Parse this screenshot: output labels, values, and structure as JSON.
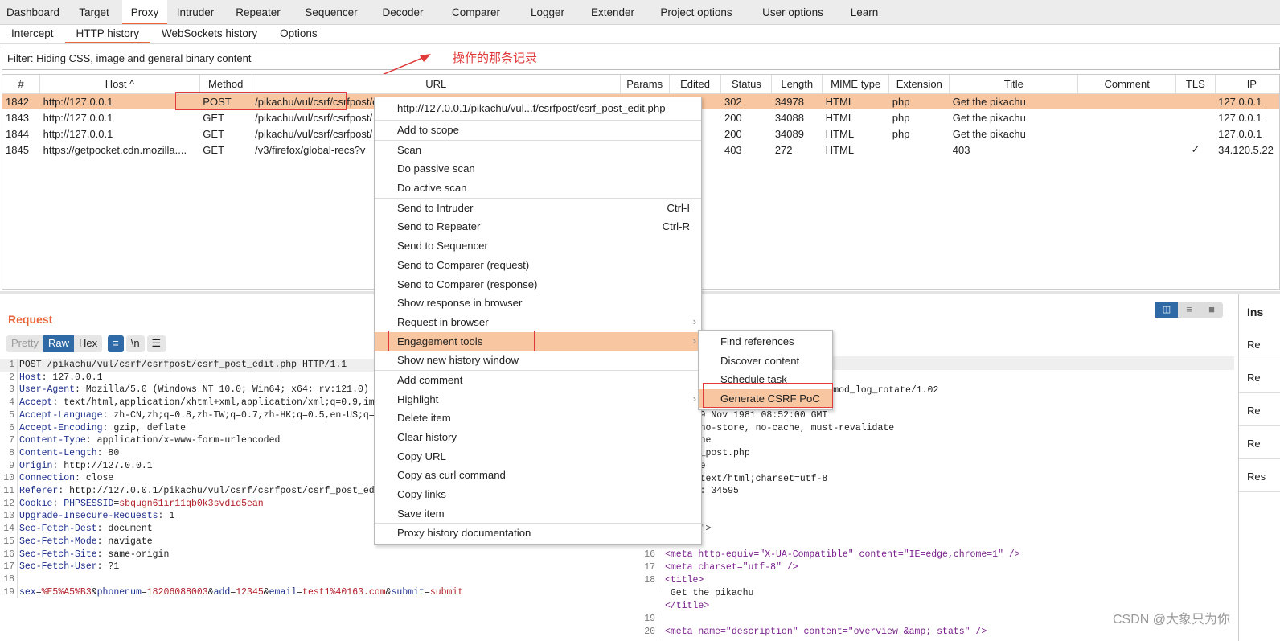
{
  "main_tabs": [
    "Dashboard",
    "Target",
    "Proxy",
    "Intruder",
    "Repeater",
    "Sequencer",
    "Decoder",
    "Comparer",
    "Logger",
    "Extender",
    "Project options",
    "User options",
    "Learn"
  ],
  "active_main_tab": "Proxy",
  "sub_tabs": [
    "Intercept",
    "HTTP history",
    "WebSockets history",
    "Options"
  ],
  "active_sub_tab": "HTTP history",
  "filter": "Filter: Hiding CSS, image and general binary content",
  "annotation": "操作的那条记录",
  "table": {
    "columns": [
      "#",
      "Host ^",
      "Method",
      "URL",
      "Params",
      "Edited",
      "Status",
      "Length",
      "MIME type",
      "Extension",
      "Title",
      "Comment",
      "TLS",
      "IP"
    ],
    "rows": [
      {
        "id": "1842",
        "host": "http://127.0.0.1",
        "method": "POST",
        "url": "/pikachu/vul/csrf/csrfpost/csrf_post_edit.php",
        "status": "302",
        "length": "34978",
        "mime": "HTML",
        "ext": "php",
        "title": "Get the pikachu",
        "tls": "",
        "ip": "127.0.0.1",
        "selected": true
      },
      {
        "id": "1843",
        "host": "http://127.0.0.1",
        "method": "GET",
        "url": "/pikachu/vul/csrf/csrfpost/",
        "status": "200",
        "length": "34088",
        "mime": "HTML",
        "ext": "php",
        "title": "Get the pikachu",
        "tls": "",
        "ip": "127.0.0.1"
      },
      {
        "id": "1844",
        "host": "http://127.0.0.1",
        "method": "GET",
        "url": "/pikachu/vul/csrf/csrfpost/",
        "status": "200",
        "length": "34089",
        "mime": "HTML",
        "ext": "php",
        "title": "Get the pikachu",
        "tls": "",
        "ip": "127.0.0.1"
      },
      {
        "id": "1845",
        "host": "https://getpocket.cdn.mozilla....",
        "method": "GET",
        "url": "/v3/firefox/global-recs?v",
        "status": "403",
        "length": "272",
        "mime": "HTML",
        "ext": "",
        "title": "403",
        "tls": "✓",
        "ip": "34.120.5.22"
      }
    ]
  },
  "request": {
    "title": "Request",
    "buttons": [
      "Pretty",
      "Raw",
      "Hex"
    ],
    "active": "Raw",
    "icons": [
      "wrap-icon",
      "newline-icon",
      "menu-icon"
    ],
    "newline_label": "\\n",
    "lines": [
      [
        [
          "",
          "POST /pikachu/vul/csrf/csrfpost/csrf_post_edit.php HTTP/1.1"
        ]
      ],
      [
        [
          "k",
          "Host"
        ],
        [
          "",
          ": 127.0.0.1"
        ]
      ],
      [
        [
          "k",
          "User-Agent"
        ],
        [
          "",
          ": Mozilla/5.0 (Windows NT 10.0; Win64; x64; rv:121.0)"
        ]
      ],
      [
        [
          "k",
          "Accept"
        ],
        [
          "",
          ": text/html,application/xhtml+xml,application/xml;q=0.9,im"
        ]
      ],
      [
        [
          "k",
          "Accept-Language"
        ],
        [
          "",
          ": zh-CN,zh;q=0.8,zh-TW;q=0.7,zh-HK;q=0.5,en-US;q="
        ]
      ],
      [
        [
          "k",
          "Accept-Encoding"
        ],
        [
          "",
          ": gzip, deflate"
        ]
      ],
      [
        [
          "k",
          "Content-Type"
        ],
        [
          "",
          ": application/x-www-form-urlencoded"
        ]
      ],
      [
        [
          "k",
          "Content-Length"
        ],
        [
          "",
          ": 80"
        ]
      ],
      [
        [
          "k",
          "Origin"
        ],
        [
          "",
          ": http://127.0.0.1"
        ]
      ],
      [
        [
          "k",
          "Connection"
        ],
        [
          "",
          ": close"
        ]
      ],
      [
        [
          "k",
          "Referer"
        ],
        [
          "",
          ": http://127.0.0.1/pikachu/vul/csrf/csrfpost/csrf_post_ed"
        ]
      ],
      [
        [
          "k",
          "Cookie"
        ],
        [
          "",
          ": "
        ],
        [
          "k",
          "PHPSESSID"
        ],
        [
          "",
          "="
        ],
        [
          "v",
          "sbqugn61ir11qb0k3svdid5ean"
        ]
      ],
      [
        [
          "k",
          "Upgrade-Insecure-Requests"
        ],
        [
          "",
          ": 1"
        ]
      ],
      [
        [
          "k",
          "Sec-Fetch-Dest"
        ],
        [
          "",
          ": document"
        ]
      ],
      [
        [
          "k",
          "Sec-Fetch-Mode"
        ],
        [
          "",
          ": navigate"
        ]
      ],
      [
        [
          "k",
          "Sec-Fetch-Site"
        ],
        [
          "",
          ": same-origin"
        ]
      ],
      [
        [
          "k",
          "Sec-Fetch-User"
        ],
        [
          "",
          ": ?1"
        ]
      ],
      [
        [
          "",
          ""
        ]
      ],
      [
        [
          "k",
          "sex"
        ],
        [
          "",
          "="
        ],
        [
          "v",
          "%E5%A5%B3"
        ],
        [
          "",
          "&"
        ],
        [
          "k",
          "phonenum"
        ],
        [
          "",
          "="
        ],
        [
          "v",
          "18206088003"
        ],
        [
          "",
          "&"
        ],
        [
          "k",
          "add"
        ],
        [
          "",
          "="
        ],
        [
          "v",
          "12345"
        ],
        [
          "",
          "&"
        ],
        [
          "k",
          "email"
        ],
        [
          "",
          "="
        ],
        [
          "v",
          "test1%40163.com"
        ],
        [
          "",
          "&"
        ],
        [
          "k",
          "submit"
        ],
        [
          "",
          "="
        ],
        [
          "v",
          "submit"
        ]
      ]
    ]
  },
  "response": {
    "fragments": [
      "T",
      "SSL/1.1.1b mod_fcgid/2.3.9a mod_log_rotate/1.02",
      "",
      "u, 19 Nov 1981 08:52:00 GMT",
      "ol: no-store, no-cache, must-revalidate",
      "-cache",
      "csrf_post.php",
      "  close",
      "pe: text/html;charset=utf-8",
      "ngth: 34595",
      "",
      "tml>",
      "=\"en\">"
    ],
    "lines": [
      {
        "n": "16",
        "t": "<meta http-equiv=\"X-UA-Compatible\" content=\"IE=edge,chrome=1\" />"
      },
      {
        "n": "17",
        "t": "<meta charset=\"utf-8\" />"
      },
      {
        "n": "18",
        "t": "<title>"
      },
      {
        "n": "",
        "t": "  Get the pikachu"
      },
      {
        "n": "",
        "t": "</title>"
      },
      {
        "n": "19",
        "t": ""
      },
      {
        "n": "20",
        "t": "<meta name=\"description\" content=\"overview &amp; stats\" />"
      }
    ]
  },
  "inspector": {
    "title": "Ins",
    "items": [
      "Re",
      "Re",
      "Re",
      "Re",
      "Res"
    ]
  },
  "context_menu": {
    "header": "http://127.0.0.1/pikachu/vul...f/csrfpost/csrf_post_edit.php",
    "groups": [
      [
        {
          "label": "Add to scope"
        }
      ],
      [
        {
          "label": "Scan"
        },
        {
          "label": "Do passive scan"
        },
        {
          "label": "Do active scan"
        }
      ],
      [
        {
          "label": "Send to Intruder",
          "shortcut": "Ctrl-I"
        },
        {
          "label": "Send to Repeater",
          "shortcut": "Ctrl-R"
        },
        {
          "label": "Send to Sequencer"
        },
        {
          "label": "Send to Comparer (request)"
        },
        {
          "label": "Send to Comparer (response)"
        },
        {
          "label": "Show response in browser"
        },
        {
          "label": "Request in browser",
          "submenu": true
        },
        {
          "label": "Engagement tools",
          "submenu": true,
          "highlighted": true
        },
        {
          "label": "Show new history window"
        }
      ],
      [
        {
          "label": "Add comment"
        },
        {
          "label": "Highlight",
          "submenu": true
        },
        {
          "label": "Delete item"
        },
        {
          "label": "Clear history"
        },
        {
          "label": "Copy URL"
        },
        {
          "label": "Copy as curl command"
        },
        {
          "label": "Copy links"
        },
        {
          "label": "Save item"
        }
      ],
      [
        {
          "label": "Proxy history documentation"
        }
      ]
    ]
  },
  "submenu": {
    "items": [
      "Find references",
      "Discover content",
      "Schedule task",
      "Generate CSRF PoC"
    ],
    "highlighted": "Generate CSRF PoC"
  },
  "watermark": "CSDN @大象只为你",
  "colors": {
    "accent": "#e8663a",
    "selection": "#f8c6a0",
    "annotation": "#e03a3a",
    "toggle_active": "#2f6aa6"
  }
}
